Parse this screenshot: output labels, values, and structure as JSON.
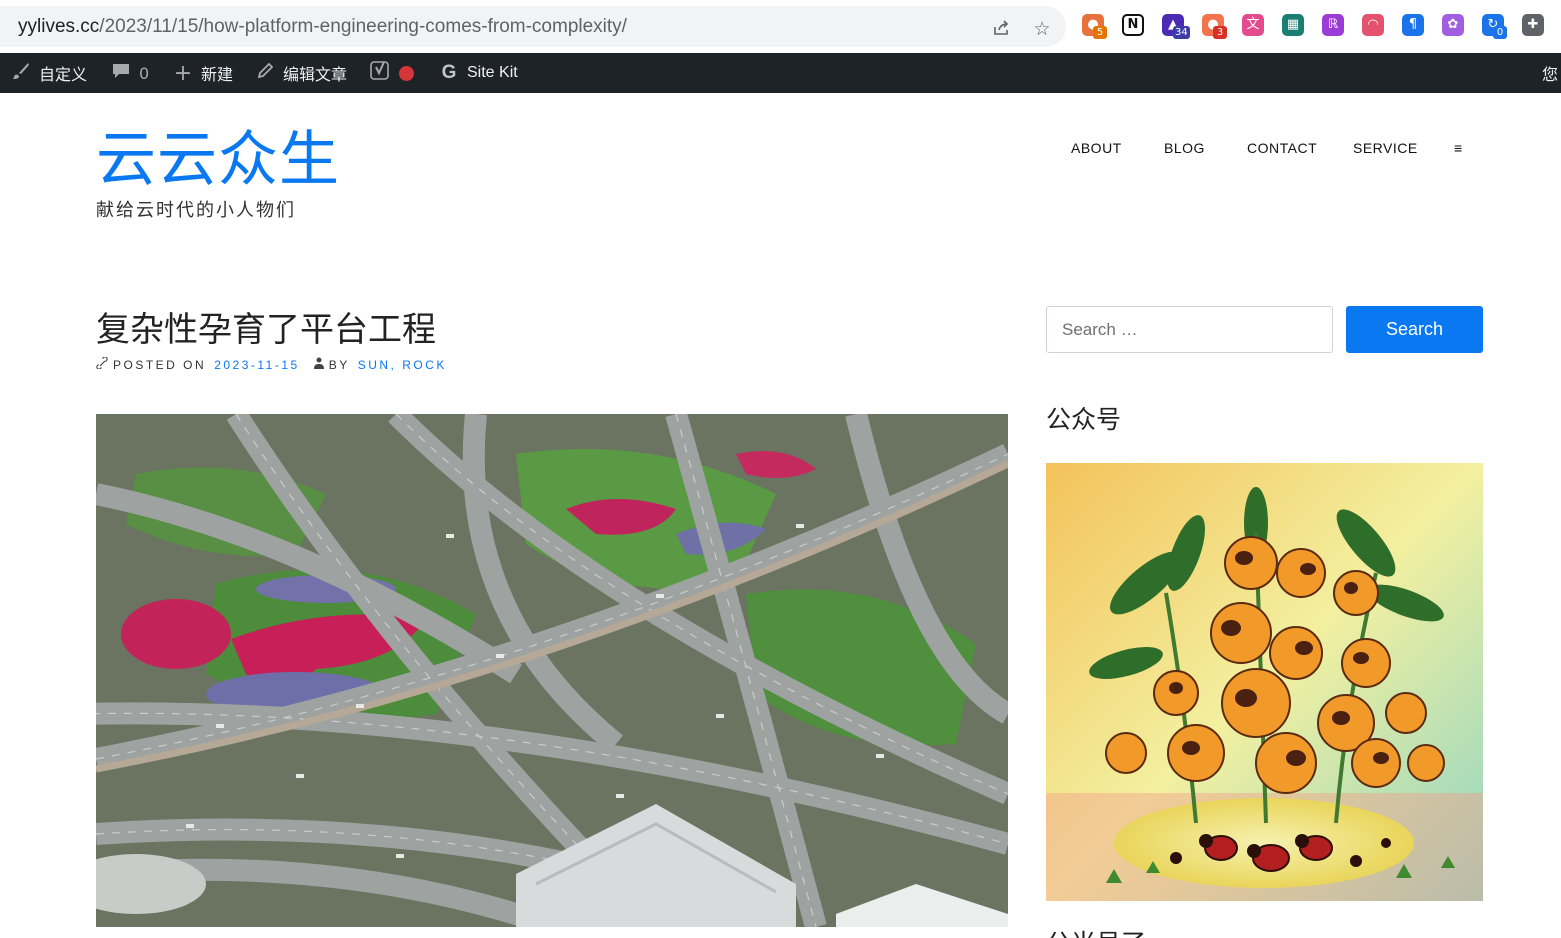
{
  "browser": {
    "url_host": "yylives.cc",
    "url_path": "/2023/11/15/how-platform-engineering-comes-from-complexity/",
    "icons": [
      "share-icon",
      "star-icon"
    ],
    "extensions": [
      {
        "name": "chrome-ext-1",
        "badge": "5",
        "color": "#e8703a",
        "badge_color": "#e37400"
      },
      {
        "name": "notion-ext",
        "badge": "",
        "color": "#ffffff",
        "badge_color": ""
      },
      {
        "name": "graduation-ext",
        "badge": "34",
        "color": "#4b2bb5",
        "badge_color": "#3c3ba8"
      },
      {
        "name": "chat-ext",
        "badge": "3",
        "color": "#f3734d",
        "badge_color": "#d93025"
      },
      {
        "name": "translate-ext",
        "badge": "",
        "color": "#e34b8e",
        "badge_color": ""
      },
      {
        "name": "grid-ext",
        "badge": "",
        "color": "#1a7e72",
        "badge_color": ""
      },
      {
        "name": "lr-ext",
        "badge": "",
        "color": "#9b3cd6",
        "badge_color": ""
      },
      {
        "name": "weibo-ext",
        "badge": "",
        "color": "#e4526e",
        "badge_color": ""
      },
      {
        "name": "pilcrow-ext",
        "badge": "",
        "color": "#1a73e8",
        "badge_color": ""
      },
      {
        "name": "openai-ext",
        "badge": "",
        "color": "#a25ee0",
        "badge_color": ""
      },
      {
        "name": "sync-ext",
        "badge": "0",
        "color": "#1a73e8",
        "badge_color": "#1a73e8"
      },
      {
        "name": "puzzle-ext",
        "badge": "",
        "color": "#5f6368",
        "badge_color": ""
      }
    ]
  },
  "adminbar": {
    "customize": "自定义",
    "comments_count": "0",
    "new": "新建",
    "edit": "编辑文章",
    "sitekit": "Site Kit",
    "greeting": "您"
  },
  "site": {
    "title": "云云众生",
    "description": "献给云时代的小人物们",
    "accent": "#0a78f0"
  },
  "nav": {
    "items": [
      "ABOUT",
      "BLOG",
      "CONTACT",
      "SERVICE",
      "≡"
    ]
  },
  "post": {
    "title": "复杂性孕育了平台工程",
    "posted_on_label": "POSTED ON",
    "date": "2023-11-15",
    "by_label": "BY",
    "author": "SUN, ROCK"
  },
  "sidebar": {
    "search_placeholder": "Search …",
    "search_button": "Search",
    "widget_title": "公众号",
    "widget2_title": "公当号了"
  }
}
